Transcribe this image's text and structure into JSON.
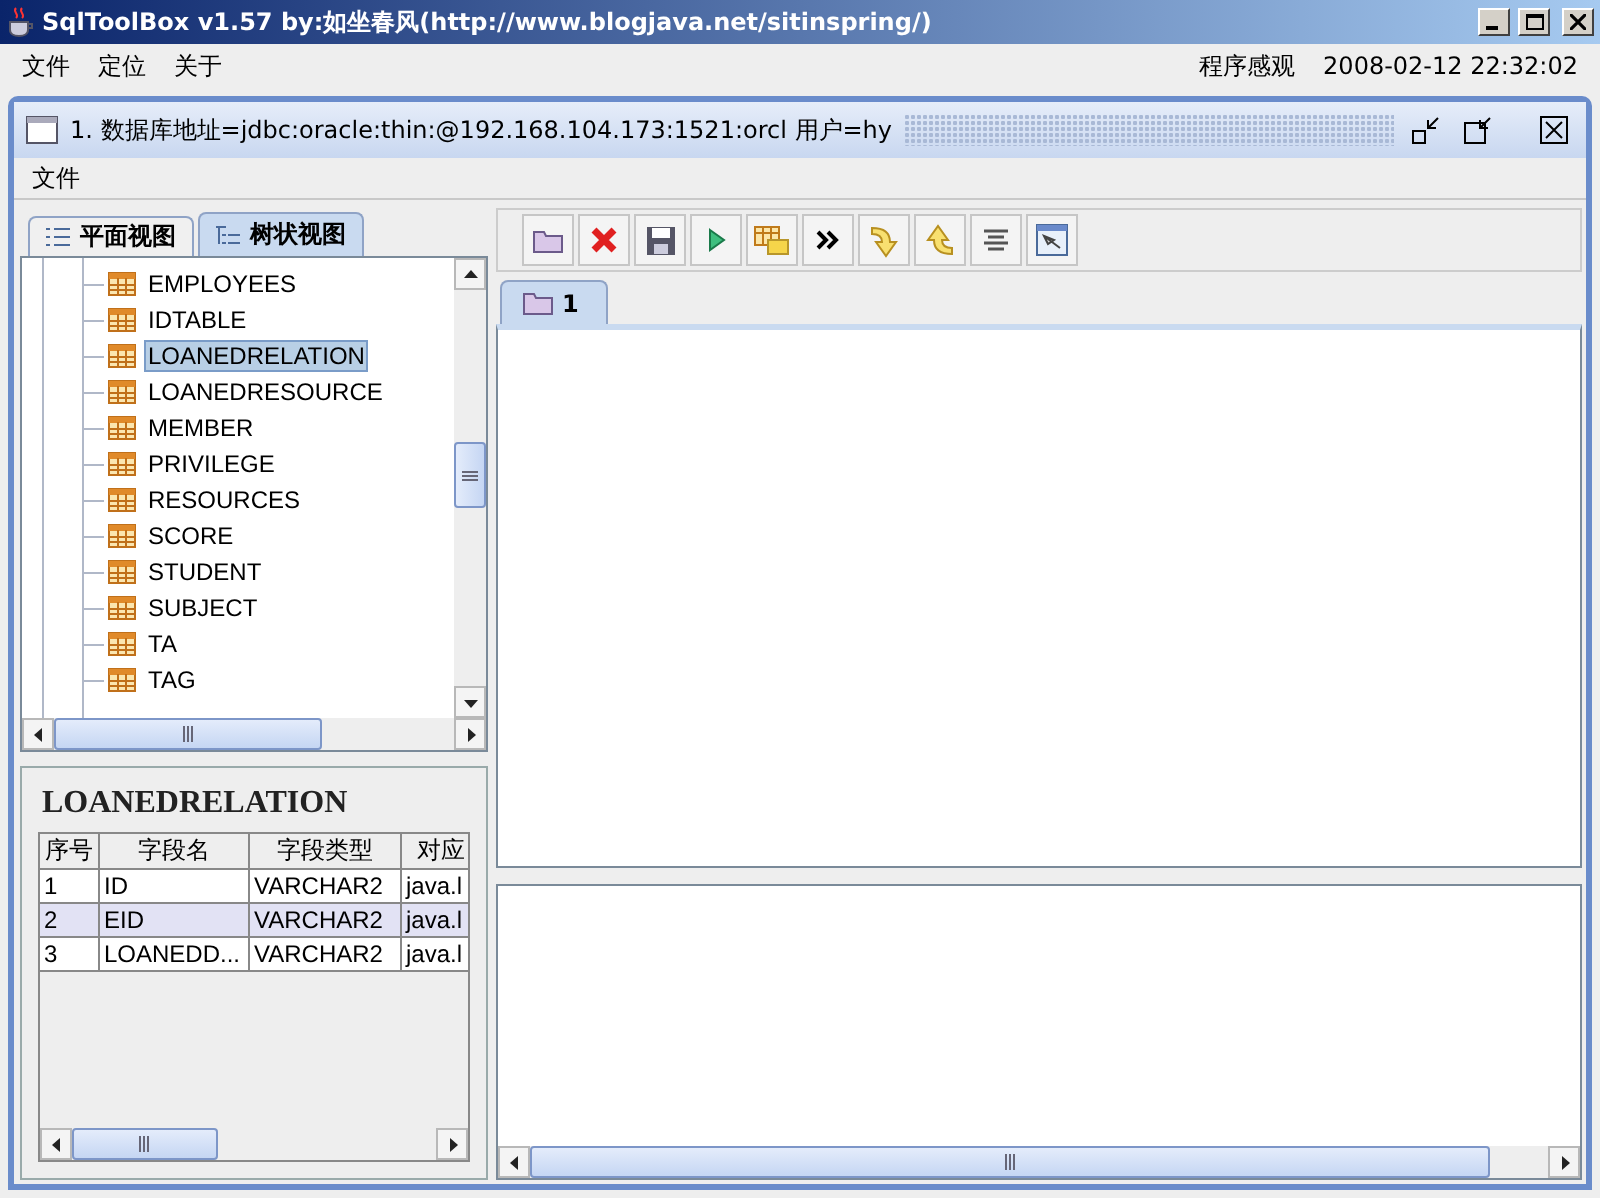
{
  "window": {
    "title": "SqlToolBox v1.57 by:如坐春风(http://www.blogjava.net/sitinspring/)"
  },
  "menu_bar": {
    "items": [
      "文件",
      "定位",
      "关于"
    ],
    "look_and_feel": "程序感观",
    "clock": "2008-02-12 22:32:02"
  },
  "internal_frame": {
    "title": "1. 数据库地址=jdbc:oracle:thin:@192.168.104.173:1521:orcl 用户=hy",
    "menu": [
      "文件"
    ]
  },
  "left_tabs": [
    {
      "label": "平面视图",
      "selected": false
    },
    {
      "label": "树状视图",
      "selected": true
    }
  ],
  "tree": {
    "items": [
      {
        "label": "EMPLOYEES",
        "selected": false
      },
      {
        "label": "IDTABLE",
        "selected": false
      },
      {
        "label": "LOANEDRELATION",
        "selected": true
      },
      {
        "label": "LOANEDRESOURCE",
        "selected": false
      },
      {
        "label": "MEMBER",
        "selected": false
      },
      {
        "label": "PRIVILEGE",
        "selected": false
      },
      {
        "label": "RESOURCES",
        "selected": false
      },
      {
        "label": "SCORE",
        "selected": false
      },
      {
        "label": "STUDENT",
        "selected": false
      },
      {
        "label": "SUBJECT",
        "selected": false
      },
      {
        "label": "TA",
        "selected": false
      },
      {
        "label": "TAG",
        "selected": false
      }
    ]
  },
  "field_panel": {
    "title": "LOANEDRELATION",
    "columns": [
      "序号",
      "字段名",
      "字段类型",
      "对应"
    ],
    "rows": [
      {
        "cells": [
          "1",
          "ID",
          "VARCHAR2",
          "java.l"
        ],
        "selected": false
      },
      {
        "cells": [
          "2",
          "EID",
          "VARCHAR2",
          "java.l"
        ],
        "selected": true
      },
      {
        "cells": [
          "3",
          "LOANEDD...",
          "VARCHAR2",
          "java.l"
        ],
        "selected": false
      }
    ]
  },
  "editor_tabs": [
    {
      "label": "1",
      "selected": true
    }
  ]
}
